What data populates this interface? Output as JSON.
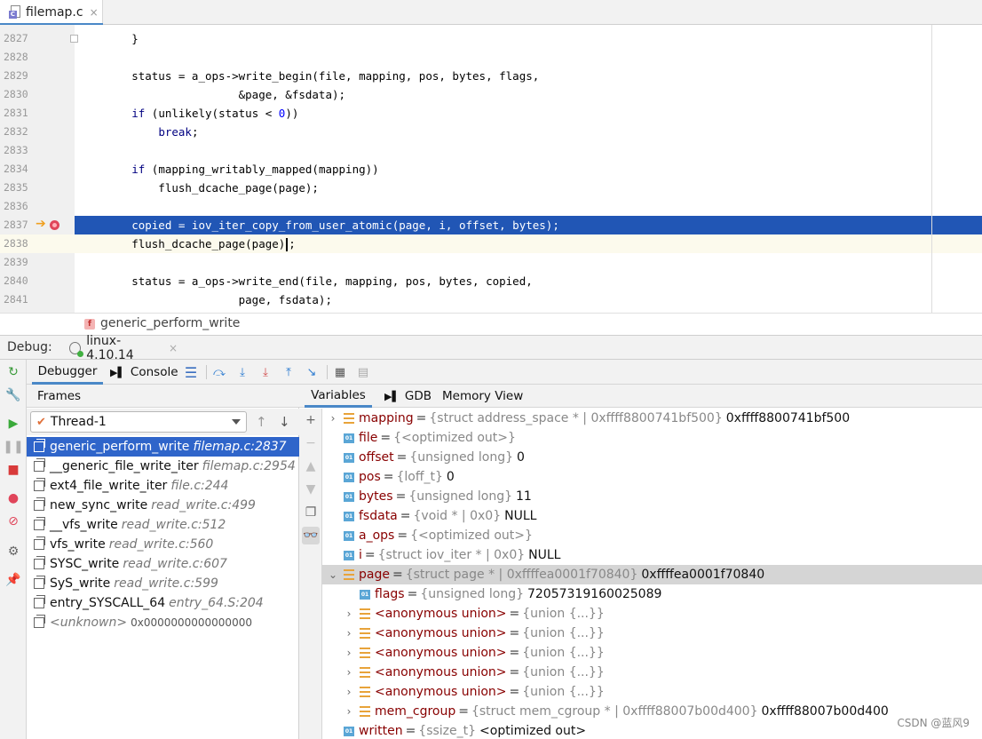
{
  "editor_tab": {
    "title": "filemap.c",
    "icon": "c-file-icon",
    "close": "×"
  },
  "editor": {
    "lines": [
      {
        "n": "2827",
        "code": [
          {
            "t": "        }"
          }
        ]
      },
      {
        "n": "2828",
        "code": []
      },
      {
        "n": "2829",
        "code": [
          {
            "t": "        status = a_ops->write_begin(file, mapping, pos, bytes, flags,"
          }
        ]
      },
      {
        "n": "2830",
        "code": [
          {
            "t": "                        &page, &fsdata);"
          }
        ]
      },
      {
        "n": "2831",
        "code": [
          {
            "t": "        "
          },
          {
            "t": "if",
            "c": "kw"
          },
          {
            "t": " (unlikely(status < "
          },
          {
            "t": "0",
            "c": "num"
          },
          {
            "t": "))"
          }
        ]
      },
      {
        "n": "2832",
        "code": [
          {
            "t": "            "
          },
          {
            "t": "break",
            "c": "kw"
          },
          {
            "t": ";"
          }
        ]
      },
      {
        "n": "2833",
        "code": []
      },
      {
        "n": "2834",
        "code": [
          {
            "t": "        "
          },
          {
            "t": "if",
            "c": "kw"
          },
          {
            "t": " (mapping_writably_mapped(mapping))"
          }
        ]
      },
      {
        "n": "2835",
        "code": [
          {
            "t": "            flush_dcache_page(page);"
          }
        ]
      },
      {
        "n": "2836",
        "code": []
      },
      {
        "n": "2837",
        "code": [
          {
            "t": "        copied = iov_iter_copy_from_user_atomic(page, i, offset, bytes);"
          }
        ]
      },
      {
        "n": "2838",
        "code": [
          {
            "t": "        flush_dcache_page(page)"
          },
          {
            "caret": true
          },
          {
            "t": ";"
          }
        ]
      },
      {
        "n": "2839",
        "code": []
      },
      {
        "n": "2840",
        "code": [
          {
            "t": "        status = a_ops->write_end(file, mapping, pos, bytes, copied,"
          }
        ]
      },
      {
        "n": "2841",
        "code": [
          {
            "t": "                        page, fsdata);"
          }
        ]
      }
    ],
    "exec_line": "2837",
    "current_line": "2838",
    "breakpoint_line": "2837"
  },
  "breadcrumb": {
    "icon_letter": "f",
    "text": "generic_perform_write"
  },
  "debug": {
    "label": "Debug:",
    "session": "linux-4.10.14",
    "close": "×"
  },
  "debug_toolbar": {
    "tabs": [
      "Debugger",
      "Console"
    ],
    "active_tab": "Debugger"
  },
  "frames": {
    "title": "Frames",
    "thread": "Thread-1",
    "items": [
      {
        "name": "generic_perform_write",
        "loc": "filemap.c:2837",
        "selected": true
      },
      {
        "name": "__generic_file_write_iter",
        "loc": "filemap.c:2954"
      },
      {
        "name": "ext4_file_write_iter",
        "loc": "file.c:244"
      },
      {
        "name": "new_sync_write",
        "loc": "read_write.c:499"
      },
      {
        "name": "__vfs_write",
        "loc": "read_write.c:512"
      },
      {
        "name": "vfs_write",
        "loc": "read_write.c:560"
      },
      {
        "name": "SYSC_write",
        "loc": "read_write.c:607"
      },
      {
        "name": "SyS_write",
        "loc": "read_write.c:599"
      },
      {
        "name": "entry_SYSCALL_64",
        "loc": "entry_64.S:204"
      },
      {
        "name": "<unknown>",
        "addr": "0x0000000000000000",
        "unknown": true
      }
    ]
  },
  "variables_tabs": [
    "Variables",
    "GDB",
    "Memory View"
  ],
  "variables": [
    {
      "indent": 0,
      "exp": "›",
      "kind": "struct",
      "name": "mapping",
      "type": "{struct address_space * | 0xffff8800741bf500}",
      "value": "0xffff8800741bf500"
    },
    {
      "indent": 0,
      "exp": "",
      "kind": "prim",
      "name": "file",
      "type": "{<optimized out>}",
      "value": ""
    },
    {
      "indent": 0,
      "exp": "",
      "kind": "prim",
      "name": "offset",
      "type": "{unsigned long}",
      "value": "0"
    },
    {
      "indent": 0,
      "exp": "",
      "kind": "prim",
      "name": "pos",
      "type": "{loff_t}",
      "value": "0"
    },
    {
      "indent": 0,
      "exp": "",
      "kind": "prim",
      "name": "bytes",
      "type": "{unsigned long}",
      "value": "11"
    },
    {
      "indent": 0,
      "exp": "",
      "kind": "prim",
      "name": "fsdata",
      "type": "{void * | 0x0}",
      "value": "NULL"
    },
    {
      "indent": 0,
      "exp": "",
      "kind": "prim",
      "name": "a_ops",
      "type": "{<optimized out>}",
      "value": ""
    },
    {
      "indent": 0,
      "exp": "",
      "kind": "prim",
      "name": "i",
      "type": "{struct iov_iter * | 0x0}",
      "value": "NULL"
    },
    {
      "indent": 0,
      "exp": "⌄",
      "kind": "struct",
      "name": "page",
      "type": "{struct page * | 0xffffea0001f70840}",
      "value": "0xffffea0001f70840",
      "highlight": true
    },
    {
      "indent": 1,
      "exp": "",
      "kind": "prim",
      "name": "flags",
      "type": "{unsigned long}",
      "value": "72057319160025089"
    },
    {
      "indent": 1,
      "exp": "›",
      "kind": "struct",
      "name": "<anonymous union>",
      "type": "{union {...}}",
      "value": ""
    },
    {
      "indent": 1,
      "exp": "›",
      "kind": "struct",
      "name": "<anonymous union>",
      "type": "{union {...}}",
      "value": ""
    },
    {
      "indent": 1,
      "exp": "›",
      "kind": "struct",
      "name": "<anonymous union>",
      "type": "{union {...}}",
      "value": ""
    },
    {
      "indent": 1,
      "exp": "›",
      "kind": "struct",
      "name": "<anonymous union>",
      "type": "{union {...}}",
      "value": ""
    },
    {
      "indent": 1,
      "exp": "›",
      "kind": "struct",
      "name": "<anonymous union>",
      "type": "{union {...}}",
      "value": ""
    },
    {
      "indent": 1,
      "exp": "›",
      "kind": "struct",
      "name": "mem_cgroup",
      "type": "{struct mem_cgroup * | 0xffff88007b00d400}",
      "value": "0xffff88007b00d400"
    },
    {
      "indent": 0,
      "exp": "",
      "kind": "prim",
      "name": "written",
      "type": "{ssize_t}",
      "value": "<optimized out>"
    }
  ],
  "watermark": "CSDN @蓝风9",
  "colors": {
    "accent": "#2156b5",
    "selection": "#2f65ca",
    "var_name": "#880000"
  }
}
